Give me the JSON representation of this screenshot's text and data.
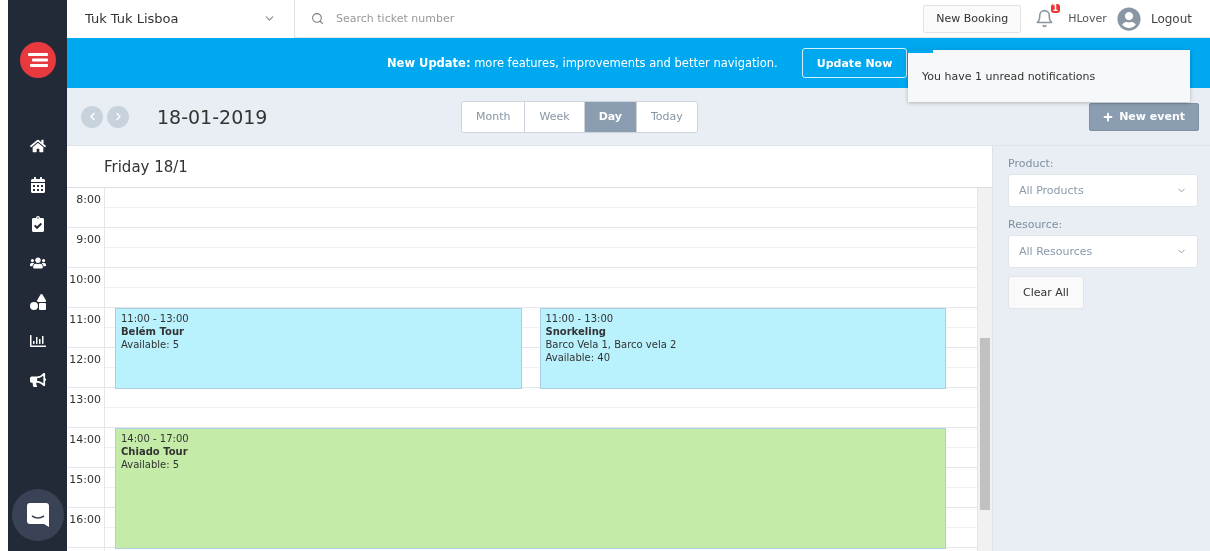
{
  "topbar": {
    "company": "Tuk Tuk Lisboa",
    "search": {
      "placeholder": "Search ticket number"
    },
    "new_booking": "New Booking",
    "notification_count": "1",
    "user": "HLover",
    "logout": "Logout"
  },
  "banner": {
    "title": "New Update:",
    "text": "more features, improvements and better navigation.",
    "button": "Update Now"
  },
  "notification_popup": {
    "text": "You have 1 unread notifications"
  },
  "toolbar": {
    "date": "18-01-2019",
    "views": [
      {
        "label": "Month",
        "selected": false
      },
      {
        "label": "Week",
        "selected": false
      },
      {
        "label": "Day",
        "selected": true
      },
      {
        "label": "Today",
        "selected": false
      }
    ],
    "new_event": "New event"
  },
  "calendar": {
    "day_title": "Friday 18/1",
    "hours": [
      "8:00",
      "9:00",
      "10:00",
      "11:00",
      "12:00",
      "13:00",
      "14:00",
      "15:00",
      "16:00"
    ],
    "events": [
      {
        "time": "11:00 - 13:00",
        "title": "Belém Tour",
        "available": "Available: 5",
        "color": "#b9f1fc"
      },
      {
        "time": "11:00 - 13:00",
        "title": "Snorkeling",
        "resources": "Barco Vela 1, Barco vela 2",
        "available": "Available: 40",
        "color": "#b9f1fc"
      },
      {
        "time": "14:00 - 17:00",
        "title": "Chiado Tour",
        "available": "Available: 5",
        "color": "#c4eca8"
      }
    ]
  },
  "filters": {
    "product_label": "Product:",
    "product_value": "All Products",
    "resource_label": "Resource:",
    "resource_value": "All Resources",
    "clear": "Clear All"
  }
}
